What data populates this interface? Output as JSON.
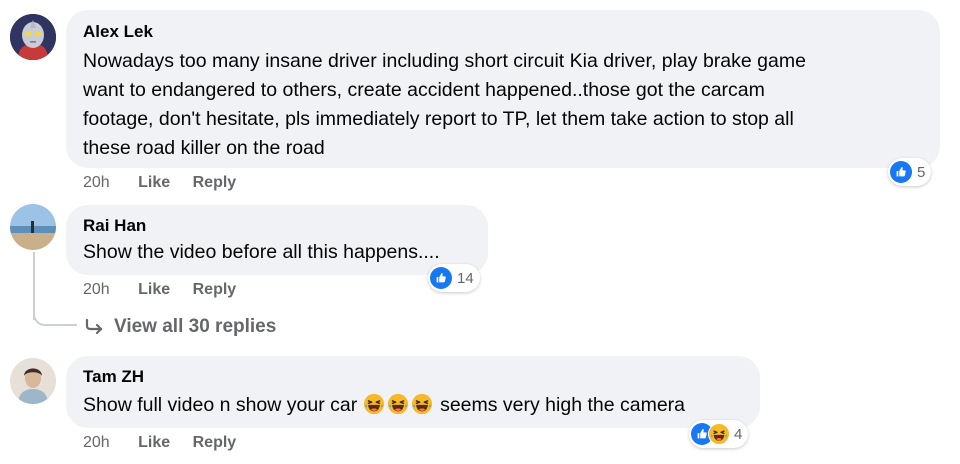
{
  "comments": [
    {
      "author": "Alex Lek",
      "text_lines": [
        "Nowadays too many insane driver including short circuit Kia driver, play brake game",
        "want to endangered to others, create accident happened..those got the carcam",
        "footage, don't hesitate, pls immediately report to TP, let them take action to stop all",
        "these road killer on the road"
      ],
      "time": "20h",
      "like": "Like",
      "reply": "Reply",
      "reaction_count": "5"
    },
    {
      "author": "Rai Han",
      "text": "Show the video before all this happens....",
      "time": "20h",
      "like": "Like",
      "reply": "Reply",
      "reaction_count": "14",
      "view_replies": "View all 30 replies"
    },
    {
      "author": "Tam ZH",
      "text_before": "Show full video n show your car",
      "text_after": "seems very high the camera",
      "time": "20h",
      "like": "Like",
      "reply": "Reply",
      "reaction_count": "4"
    }
  ],
  "icons": {
    "like": "thumbs-up-icon",
    "haha": "haha-emoji-icon",
    "reply_arrow": "reply-arrow-icon"
  },
  "colors": {
    "bubble": "#f0f2f5",
    "meta_text": "#65676b",
    "like_blue": "#1877f2",
    "haha_yellow": "#f7b928"
  }
}
